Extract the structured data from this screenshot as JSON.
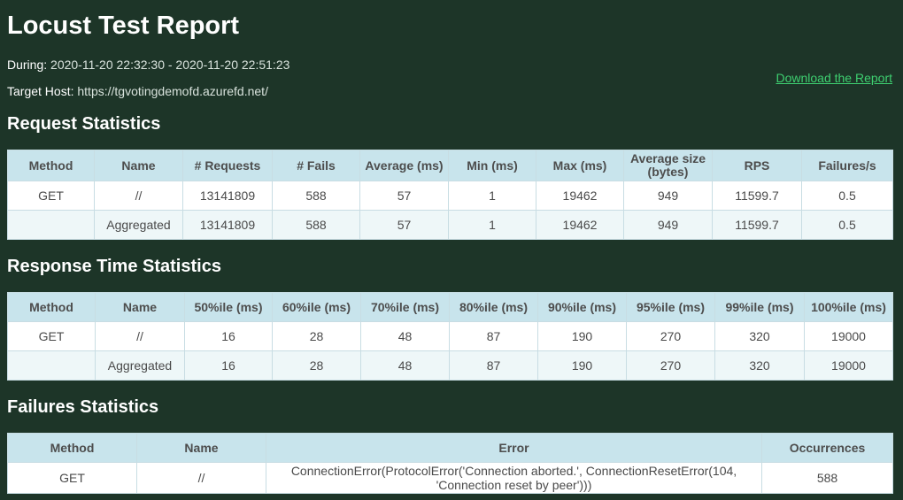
{
  "title": "Locust Test Report",
  "during": {
    "label": "During:",
    "value": "2020-11-20 22:32:30 - 2020-11-20 22:51:23"
  },
  "target_host": {
    "label": "Target Host:",
    "value": "https://tgvotingdemofd.azurefd.net/"
  },
  "download_label": "Download the Report",
  "request_stats": {
    "title": "Request Statistics",
    "headers": [
      "Method",
      "Name",
      "# Requests",
      "# Fails",
      "Average (ms)",
      "Min (ms)",
      "Max (ms)",
      "Average size (bytes)",
      "RPS",
      "Failures/s"
    ],
    "rows": [
      [
        "GET",
        "//",
        "13141809",
        "588",
        "57",
        "1",
        "19462",
        "949",
        "11599.7",
        "0.5"
      ],
      [
        "",
        "Aggregated",
        "13141809",
        "588",
        "57",
        "1",
        "19462",
        "949",
        "11599.7",
        "0.5"
      ]
    ]
  },
  "response_time_stats": {
    "title": "Response Time Statistics",
    "headers": [
      "Method",
      "Name",
      "50%ile (ms)",
      "60%ile (ms)",
      "70%ile (ms)",
      "80%ile (ms)",
      "90%ile (ms)",
      "95%ile (ms)",
      "99%ile (ms)",
      "100%ile (ms)"
    ],
    "rows": [
      [
        "GET",
        "//",
        "16",
        "28",
        "48",
        "87",
        "190",
        "270",
        "320",
        "19000"
      ],
      [
        "",
        "Aggregated",
        "16",
        "28",
        "48",
        "87",
        "190",
        "270",
        "320",
        "19000"
      ]
    ]
  },
  "failures_stats": {
    "title": "Failures Statistics",
    "headers": [
      "Method",
      "Name",
      "Error",
      "Occurrences"
    ],
    "rows": [
      [
        "GET",
        "//",
        "ConnectionError(ProtocolError('Connection aborted.', ConnectionResetError(104, 'Connection reset by peer')))",
        "588"
      ]
    ]
  }
}
